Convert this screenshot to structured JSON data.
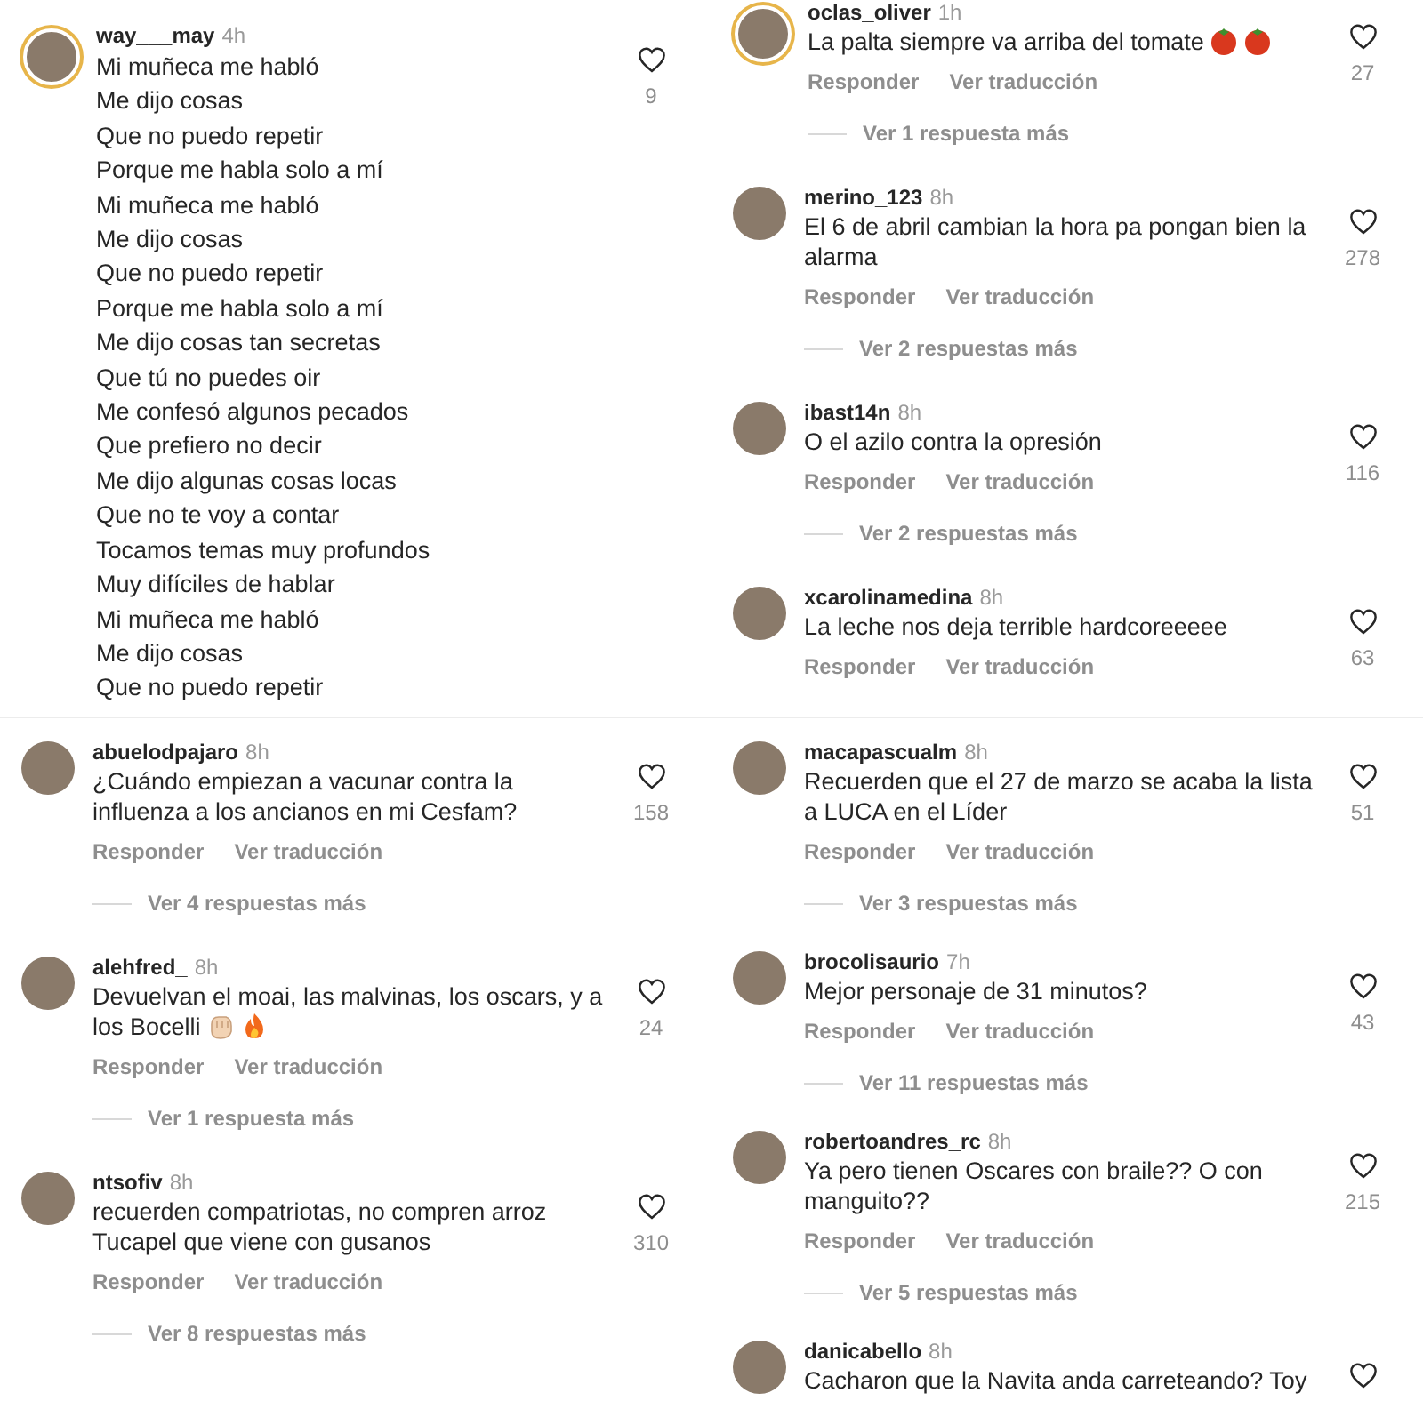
{
  "panels": [
    {
      "comments": [
        {
          "user": "way___may",
          "time": "4h",
          "story_ring": true,
          "text": "Mi muñeca me habló\nMe dijo cosas\nQue no puedo repetir\nPorque me habla solo a mí\nMi muñeca me habló\nMe dijo cosas\nQue no puedo repetir\nPorque me habla solo a mí\nMe dijo cosas tan secretas\nQue tú no puedes oir\nMe confesó algunos pecados\nQue prefiero no decir\nMe dijo algunas cosas locas\nQue no te voy a contar\nTocamos temas muy profundos\nMuy difíciles de hablar\nMi muñeca me habló\nMe dijo cosas\nQue no puedo repetir",
          "likes": "9"
        }
      ]
    },
    {
      "comments": [
        {
          "user": "abuelodpajaro",
          "time": "8h",
          "story_ring": false,
          "text": "¿Cuándo empiezan a vacunar contra la influenza a los ancianos en mi Cesfam?",
          "likes": "158",
          "reply": "Responder",
          "translate": "Ver traducción",
          "more": "Ver 4 respuestas más"
        },
        {
          "user": "alehfred_",
          "time": "8h",
          "story_ring": false,
          "text": "Devuelvan el moai, las malvinas, los oscars, y a los Bocelli",
          "emojis": [
            {
              "kind": "fist"
            },
            {
              "kind": "fire"
            }
          ],
          "likes": "24",
          "reply": "Responder",
          "translate": "Ver traducción",
          "more": "Ver 1 respuesta más"
        },
        {
          "user": "ntsofiv",
          "time": "8h",
          "story_ring": false,
          "text": "recuerden compatriotas, no compren arroz Tucapel que viene con gusanos",
          "likes": "310",
          "reply": "Responder",
          "translate": "Ver traducción",
          "more": "Ver 8 respuestas más"
        }
      ]
    },
    {
      "comments": [
        {
          "user": "oclas_oliver",
          "time": "1h",
          "story_ring": true,
          "text": "La palta siempre va arriba del tomate",
          "emojis": [
            {
              "kind": "tomato"
            },
            {
              "kind": "tomato"
            }
          ],
          "likes": "27",
          "reply": "Responder",
          "translate": "Ver traducción",
          "more": "Ver 1 respuesta más"
        },
        {
          "user": "merino_123",
          "time": "8h",
          "story_ring": false,
          "text": "El 6 de abril cambian la hora pa pongan bien la alarma",
          "likes": "278",
          "reply": "Responder",
          "translate": "Ver traducción",
          "more": "Ver 2 respuestas más"
        },
        {
          "user": "ibast14n",
          "time": "8h",
          "story_ring": false,
          "text": "O el azilo contra la opresión",
          "likes": "116",
          "reply": "Responder",
          "translate": "Ver traducción",
          "more": "Ver 2 respuestas más"
        },
        {
          "user": "xcarolinamedina",
          "time": "8h",
          "story_ring": false,
          "text": "La leche nos deja terrible hardcoreeeee",
          "likes": "63",
          "reply": "Responder",
          "translate": "Ver traducción"
        }
      ]
    },
    {
      "comments": [
        {
          "user": "macapascualm",
          "time": "8h",
          "story_ring": false,
          "text": "Recuerden que el 27 de marzo se acaba la lista a LUCA en el Líder",
          "likes": "51",
          "reply": "Responder",
          "translate": "Ver traducción",
          "more": "Ver 3 respuestas más"
        },
        {
          "user": "brocolisaurio",
          "time": "7h",
          "story_ring": false,
          "text": "Mejor personaje de 31 minutos?",
          "likes": "43",
          "reply": "Responder",
          "translate": "Ver traducción",
          "more": "Ver 11 respuestas más"
        },
        {
          "user": "robertoandres_rc",
          "time": "8h",
          "story_ring": false,
          "text": "Ya pero tienen Oscares con braile?? O con manguito??",
          "likes": "215",
          "reply": "Responder",
          "translate": "Ver traducción",
          "more": "Ver 5 respuestas más"
        },
        {
          "user": "danicabello",
          "time": "8h",
          "story_ring": false,
          "text": "Cacharon que la Navita anda carreteando? Toy"
        }
      ]
    }
  ]
}
